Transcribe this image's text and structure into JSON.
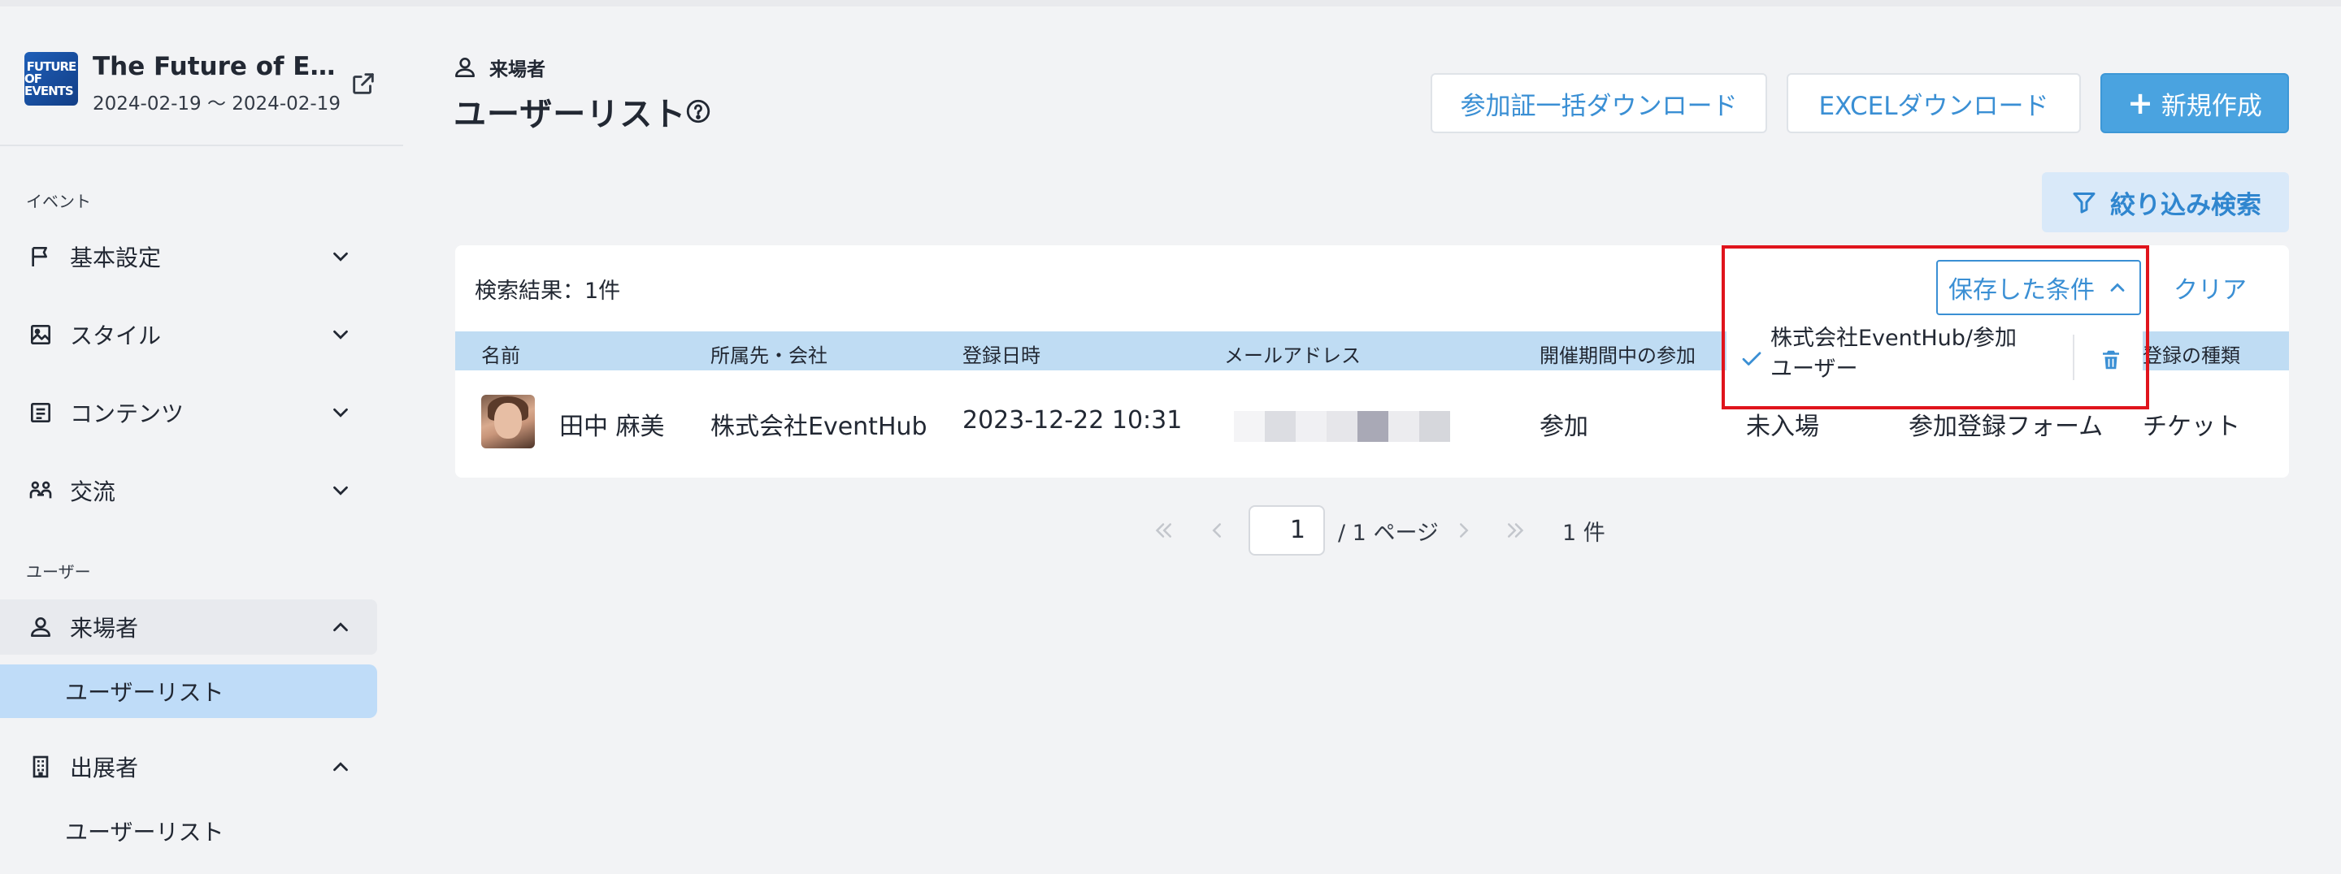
{
  "event": {
    "logo_lines": [
      "FUTURE",
      "OF EVENTS"
    ],
    "title": "The Future of Eve...",
    "dates": "2024-02-19 〜 2024-02-19"
  },
  "sidebar": {
    "section_event": "イベント",
    "section_user": "ユーザー",
    "items": [
      {
        "label": "基本設定",
        "icon": "flag-icon"
      },
      {
        "label": "スタイル",
        "icon": "image-icon"
      },
      {
        "label": "コンテンツ",
        "icon": "list-icon"
      },
      {
        "label": "交流",
        "icon": "people-icon"
      },
      {
        "label": "来場者",
        "icon": "user-icon"
      },
      {
        "label": "出展者",
        "icon": "building-icon"
      }
    ],
    "visitor_sub": "ユーザーリスト",
    "exhibitor_sub": "ユーザーリスト"
  },
  "header": {
    "breadcrumb": "来場者",
    "title": "ユーザーリスト"
  },
  "toolbar": {
    "bulk_download": "参加証一括ダウンロード",
    "excel_download": "EXCELダウンロード",
    "create_new": "新規作成",
    "create_icon": "+",
    "filter_search": "絞り込み検索"
  },
  "results": {
    "count_text": "検索結果：1件",
    "saved_conditions": "保存した条件",
    "clear": "クリア"
  },
  "saved_dropdown": {
    "item_line1": "株式会社EventHub/参加",
    "item_line2": "ユーザー"
  },
  "table": {
    "columns": [
      "名前",
      "所属先・会社",
      "登録日時",
      "メールアドレス",
      "開催期間中の参加",
      "",
      "",
      "登録の種類"
    ],
    "rows": [
      {
        "name": "田中 麻美",
        "company": "株式会社EventHub",
        "registered": "2023-12-22 10:31",
        "participation": "参加",
        "entry": "未入場",
        "form": "参加登録フォーム",
        "type": "チケット"
      }
    ]
  },
  "pagination": {
    "current": "1",
    "total": "/ 1 ページ",
    "count": "1 件"
  },
  "colors": {
    "accent": "#3a8fd4",
    "primary_button": "#4aa3e0",
    "table_header": "#bfdcf3",
    "active_nav": "#bfdcf8",
    "highlight": "#e0141c"
  }
}
